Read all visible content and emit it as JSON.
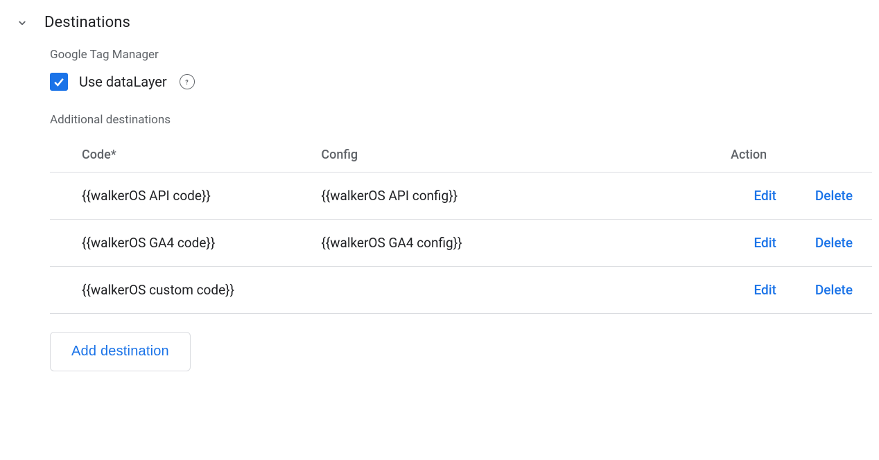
{
  "section": {
    "title": "Destinations"
  },
  "gtm": {
    "label": "Google Tag Manager",
    "checkbox_label": "Use dataLayer",
    "checked": true
  },
  "additional": {
    "label": "Additional destinations",
    "columns": {
      "code": "Code*",
      "config": "Config",
      "action": "Action"
    },
    "rows": [
      {
        "code": "{{walkerOS API code}}",
        "config": "{{walkerOS API config}}"
      },
      {
        "code": "{{walkerOS GA4 code}}",
        "config": "{{walkerOS GA4 config}}"
      },
      {
        "code": "{{walkerOS custom code}}",
        "config": ""
      }
    ],
    "actions": {
      "edit": "Edit",
      "delete": "Delete"
    },
    "add_button": "Add destination"
  }
}
